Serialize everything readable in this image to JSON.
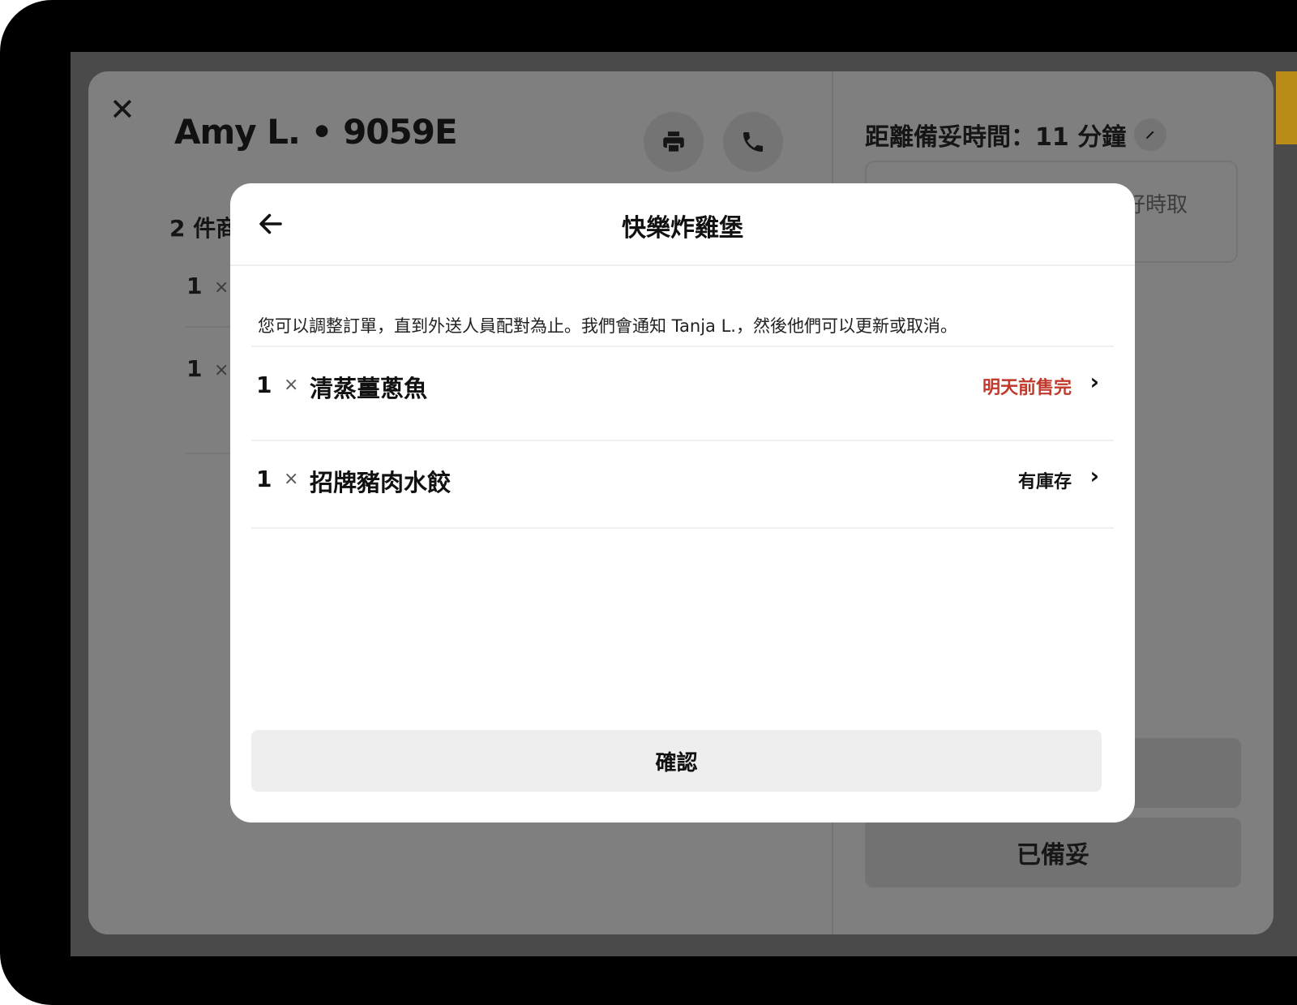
{
  "order": {
    "title": "Amy L. • 9059E",
    "items_count_label": "2 件商",
    "items": [
      {
        "qty": "1",
        "times": "×"
      },
      {
        "qty": "1",
        "times": "×"
      }
    ],
    "ready_time_label": "距離備妥時間：11 分鐘",
    "pickup_hint": "好時取",
    "ready_button_label": "已備妥"
  },
  "modal": {
    "title": "快樂炸雞堡",
    "info": "您可以調整訂單，直到外送人員配對為止。我們會通知 Tanja L.，然後他們可以更新或取消。",
    "items": [
      {
        "qty": "1",
        "times": "×",
        "name": "清蒸薑蔥魚",
        "status": "明天前售完",
        "status_color": "#c0392b",
        "chevron": "›"
      },
      {
        "qty": "1",
        "times": "×",
        "name": "招牌豬肉水餃",
        "status": "有庫存",
        "status_color": "#111111",
        "chevron": "›"
      }
    ],
    "confirm_label": "確認"
  },
  "icons": {
    "close": "close-icon",
    "print": "printer-icon",
    "phone": "phone-icon",
    "edit": "pencil-icon",
    "back": "arrow-left-icon",
    "chevron": "chevron-right-icon"
  },
  "colors": {
    "overlay_panel": "#7f7f7f",
    "accent_strip": "#b98b17",
    "sold_out": "#c0392b"
  }
}
